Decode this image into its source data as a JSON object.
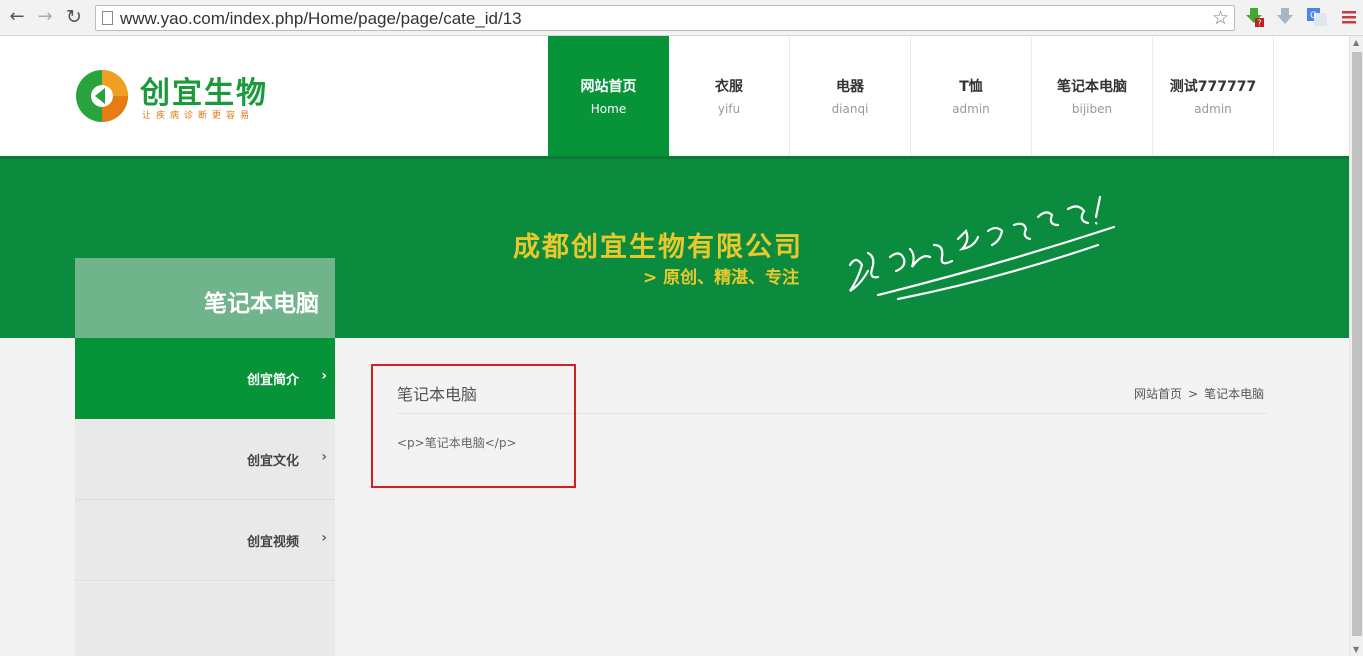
{
  "browser": {
    "url": "www.yao.com/index.php/Home/page/page/cate_id/13",
    "back_icon": "←",
    "forward_icon": "→",
    "reload_icon": "↻",
    "star_icon": "☆"
  },
  "logo": {
    "name": "创宜生物",
    "slogan": "让疾病诊断更容易"
  },
  "nav": [
    {
      "cn": "网站首页",
      "en": "Home",
      "active": true
    },
    {
      "cn": "衣服",
      "en": "yifu"
    },
    {
      "cn": "电器",
      "en": "dianqi"
    },
    {
      "cn": "T恤",
      "en": "admin"
    },
    {
      "cn": "笔记本电脑",
      "en": "bijiben"
    },
    {
      "cn": "测试777777",
      "en": "admin"
    }
  ],
  "banner": {
    "title": "成都创宜生物有限公司",
    "subtitle": "> 原创、精湛、专注"
  },
  "sidebar": {
    "title": "笔记本电脑",
    "arrow": "›",
    "items": [
      {
        "label": "创宜简介",
        "active": true
      },
      {
        "label": "创宜文化"
      },
      {
        "label": "创宜视频"
      }
    ]
  },
  "content": {
    "title": "笔记本电脑",
    "body": "<p>笔记本电脑</p>",
    "breadcrumb": {
      "home": "网站首页",
      "separator": ">",
      "current": "笔记本电脑"
    }
  },
  "colors": {
    "brand_green": "#079439",
    "banner_green": "#0a8b3d",
    "sidebar_title_bg": "#6fb48a",
    "banner_text": "#e9c82c",
    "highlight_red": "#d0201f"
  }
}
